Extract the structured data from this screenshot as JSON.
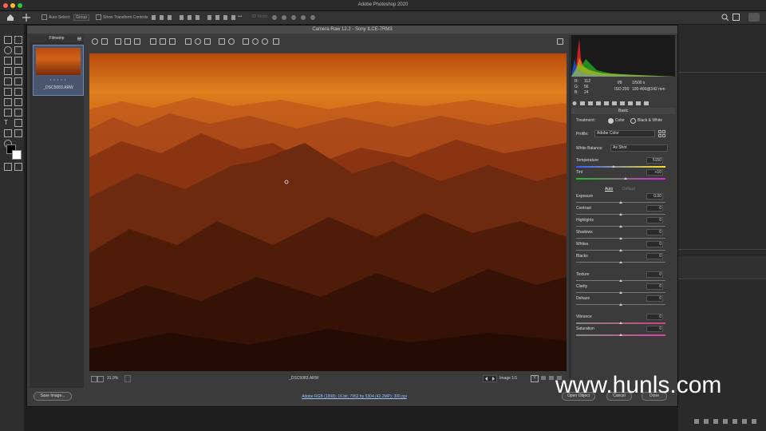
{
  "app": {
    "title": "Adobe Photoshop 2020"
  },
  "options_bar": {
    "auto_select_label": "Auto-Select:",
    "auto_select_value": "Group",
    "show_transform_label": "Show Transform Controls",
    "mode_3d": "3D Mode:"
  },
  "camera_raw": {
    "title": "Camera Raw 12.2  -  Sony ILCE-7RM3",
    "filmstrip": {
      "header": "Filmstrip",
      "stars": "• • • • •",
      "filename": "_DSC5083.ARW"
    },
    "status": {
      "zoom": "31.9%",
      "filename": "_DSC5083.ARW",
      "image_count": "Image 1/1"
    },
    "footer": {
      "save_button": "Save Image...",
      "workflow_info": "Adobe RGB (1998); 16 bit; 7952 by 5304 (42.2MP); 300 ppi",
      "open_button": "Open Object",
      "cancel_button": "Cancel",
      "done_button": "Done"
    },
    "readout": {
      "r_label": "R:",
      "r": "112",
      "g_label": "G:",
      "g": "56",
      "b_label": "B:",
      "b": "24",
      "aperture": "f/8",
      "shutter": "1/500 s",
      "iso": "ISO 200",
      "lens": "100-400@342 mm"
    },
    "basic": {
      "header": "Basic",
      "treatment_label": "Treatment:",
      "color_label": "Color",
      "bw_label": "Black & White",
      "profile_label": "Profile:",
      "profile_value": "Adobe Color",
      "wb_label": "White Balance:",
      "wb_value": "As Shot",
      "auto": "Auto",
      "default": "Default",
      "sliders": [
        {
          "label": "Temperature",
          "value": "5150",
          "pos": 0.42
        },
        {
          "label": "Tint",
          "value": "+10",
          "pos": 0.55
        },
        {
          "label": "Exposure",
          "value": "0.00",
          "pos": 0.5
        },
        {
          "label": "Contrast",
          "value": "0",
          "pos": 0.5
        },
        {
          "label": "Highlights",
          "value": "0",
          "pos": 0.5
        },
        {
          "label": "Shadows",
          "value": "0",
          "pos": 0.5
        },
        {
          "label": "Whites",
          "value": "0",
          "pos": 0.5
        },
        {
          "label": "Blacks",
          "value": "0",
          "pos": 0.5
        },
        {
          "label": "Texture",
          "value": "0",
          "pos": 0.5
        },
        {
          "label": "Clarity",
          "value": "0",
          "pos": 0.5
        },
        {
          "label": "Dehaze",
          "value": "0",
          "pos": 0.5
        },
        {
          "label": "Vibrance",
          "value": "0",
          "pos": 0.5
        },
        {
          "label": "Saturation",
          "value": "0",
          "pos": 0.5
        }
      ]
    }
  },
  "watermark": "www.hunls.com",
  "colors": {
    "accent": "#6b8ab8",
    "link": "#9bc4ff",
    "sunset": "#d06218"
  }
}
